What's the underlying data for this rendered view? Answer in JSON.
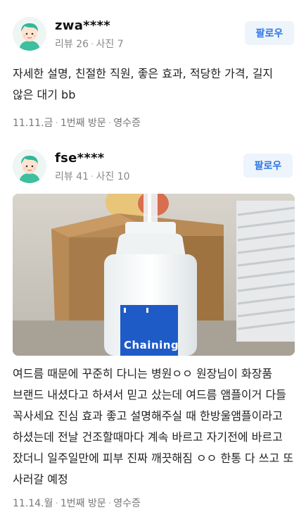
{
  "reviews": [
    {
      "user": "zwa****",
      "reviews_label": "리뷰 26",
      "photos_label": "사진 7",
      "follow_label": "팔로우",
      "text": "자세한 설명, 친절한 직원, 좋은 효과, 적당한 가격, 길지 않은 대기 bb",
      "date": "11.11.금",
      "visit": "1번째 방문",
      "receipt": "영수증"
    },
    {
      "user": "fse****",
      "reviews_label": "리뷰 41",
      "photos_label": "사진 10",
      "follow_label": "팔로우",
      "photo_label_text": "Chaining",
      "text": "여드름 때문에 꾸준히 다니는 병원ㅇㅇ 원장님이 화장품 브랜드 내셨다고 하셔서 믿고 샀는데 여드름 앰플이거 다들 꼭사세요 진심 효과 좋고 설명해주실 때 한방울앰플이라고 하셨는데 전날 건조할때마다 계속 바르고 자기전에 바르고 잤더니 일주일만에 피부 진짜 깨끗해짐 ㅇㅇ 한통 다 쓰고 또 사러갈 예정",
      "date": "11.14.월",
      "visit": "1번째 방문",
      "receipt": "영수증"
    }
  ],
  "colors": {
    "follow_text": "#2f77e5",
    "follow_bg": "#eef4fc",
    "meta_text": "#777777"
  }
}
